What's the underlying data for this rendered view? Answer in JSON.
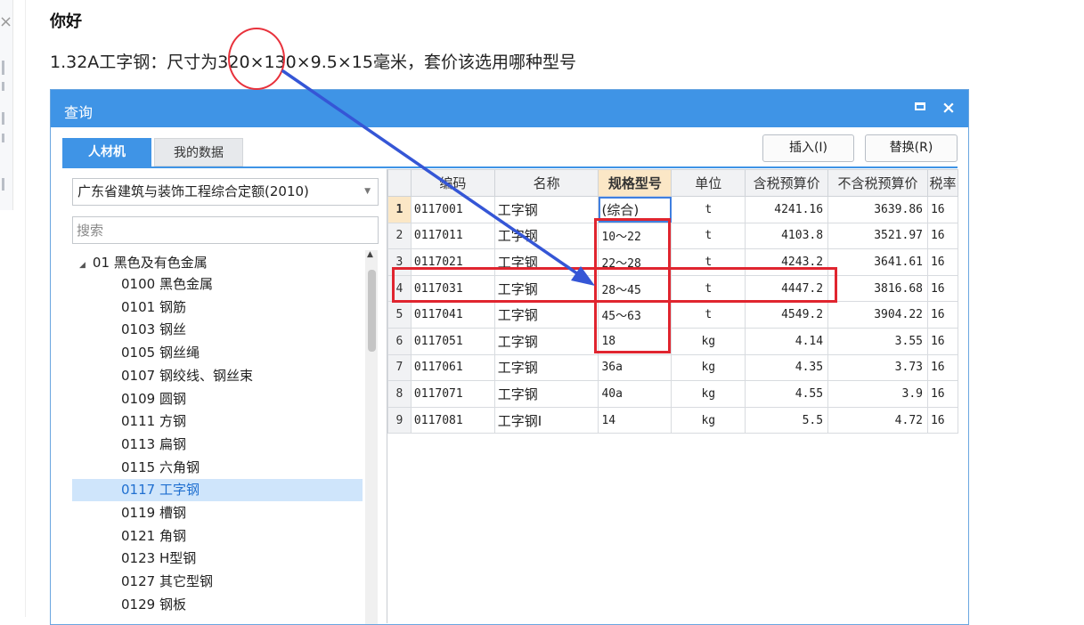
{
  "post": {
    "greeting": "你好",
    "question": "1.32A工字钢：尺寸为320×130×9.5×15毫米，套价该选用哪种型号"
  },
  "left_panel": {
    "close_glyph": "×"
  },
  "dialog": {
    "title": "查询",
    "tabs": [
      "人材机",
      "我的数据"
    ],
    "buttons": {
      "insert": "插入(I)",
      "replace": "替换(R)"
    },
    "quota_select": "广东省建筑与装饰工程综合定额(2010)",
    "search_placeholder": "搜索",
    "tree": {
      "parent": "01 黑色及有色金属",
      "items": [
        "0100 黑色金属",
        "0101 钢筋",
        "0103 钢丝",
        "0105 钢丝绳",
        "0107 钢绞线、钢丝束",
        "0109 圆钢",
        "0111 方钢",
        "0113 扁钢",
        "0115 六角钢",
        "0117 工字钢",
        "0119 槽钢",
        "0121 角钢",
        "0123 H型钢",
        "0127 其它型钢",
        "0129 钢板"
      ],
      "selected_index": 9
    },
    "grid": {
      "headers": [
        "编码",
        "名称",
        "规格型号",
        "单位",
        "含税预算价",
        "不含税预算价",
        "税率"
      ],
      "selected_header": 2,
      "rows": [
        {
          "no": "1",
          "code": "0117001",
          "name": "工字钢",
          "spec": "(综合)",
          "unit": "t",
          "tax_price": "4241.16",
          "notax_price": "3639.86",
          "rate": "16"
        },
        {
          "no": "2",
          "code": "0117011",
          "name": "工字钢",
          "spec": "10～22",
          "unit": "t",
          "tax_price": "4103.8",
          "notax_price": "3521.97",
          "rate": "16"
        },
        {
          "no": "3",
          "code": "0117021",
          "name": "工字钢",
          "spec": "22～28",
          "unit": "t",
          "tax_price": "4243.2",
          "notax_price": "3641.61",
          "rate": "16"
        },
        {
          "no": "4",
          "code": "0117031",
          "name": "工字钢",
          "spec": "28～45",
          "unit": "t",
          "tax_price": "4447.2",
          "notax_price": "3816.68",
          "rate": "16"
        },
        {
          "no": "5",
          "code": "0117041",
          "name": "工字钢",
          "spec": "45～63",
          "unit": "t",
          "tax_price": "4549.2",
          "notax_price": "3904.22",
          "rate": "16"
        },
        {
          "no": "6",
          "code": "0117051",
          "name": "工字钢",
          "spec": "18",
          "unit": "kg",
          "tax_price": "4.14",
          "notax_price": "3.55",
          "rate": "16"
        },
        {
          "no": "7",
          "code": "0117061",
          "name": "工字钢",
          "spec": "36a",
          "unit": "kg",
          "tax_price": "4.35",
          "notax_price": "3.73",
          "rate": "16"
        },
        {
          "no": "8",
          "code": "0117071",
          "name": "工字钢",
          "spec": "40a",
          "unit": "kg",
          "tax_price": "4.55",
          "notax_price": "3.9",
          "rate": "16"
        },
        {
          "no": "9",
          "code": "0117081",
          "name": "工字钢I",
          "spec": "14",
          "unit": "kg",
          "tax_price": "5.5",
          "notax_price": "4.72",
          "rate": "16"
        }
      ],
      "current_row": 0
    }
  },
  "colors": {
    "accent": "#3f94e6",
    "annotation_red": "#e0252f",
    "arrow_blue": "#3556d6"
  }
}
